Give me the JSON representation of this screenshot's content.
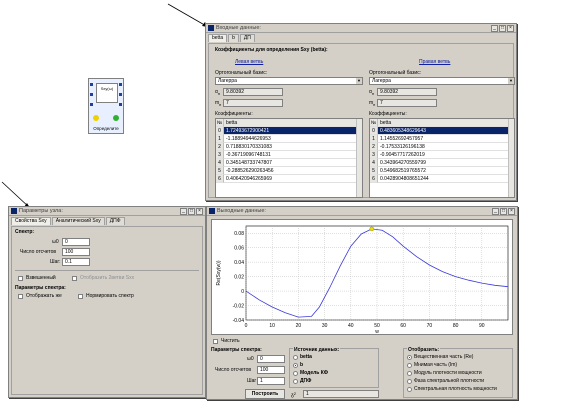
{
  "win_input": {
    "title": "Входные данные:",
    "tabs": [
      "betta",
      "b",
      "ДП"
    ],
    "heading": "Коэффициенты для определения Sxy (betta):",
    "left_link": "Левая ветвь",
    "right_link": "Правая ветвь",
    "basis_label": "Ортогональный базис:",
    "basis_value": "Лагерра",
    "alpha_label": "α",
    "alpha_sub": "п",
    "alpha_value": "9.80392",
    "m_label": "m",
    "m_sub": "п",
    "m_value": "7",
    "coeff_label": "Коэффициенты:",
    "col_n": "№",
    "col_betta": "betta",
    "left_coeffs": [
      "1.72493672900421",
      "-1.18894944626953",
      "0.718830170331083",
      "-0.36719096748131",
      "0.345148733747807",
      "-0.288526290263456",
      "0.406420946265969"
    ],
    "right_coeffs": [
      "0.483605348629643",
      "1.14552692457957",
      "-0.17533126196138",
      "-0.90457717262019",
      "0.343964270559799",
      "0.549682519765572",
      "0.0428904808651244"
    ],
    "left_alpha": "9.80392",
    "left_m": "7",
    "right_alpha": "9.80392",
    "right_m": "7"
  },
  "win_params": {
    "title": "Параметры узла:",
    "tabs": [
      "Свойства Sxy",
      "Аналитический Sxy",
      "ДПФ"
    ],
    "spectrum_label": "Спектр:",
    "w0_label": "ω0",
    "w0_value": "0",
    "count_label": "Число отсчетов",
    "count_value": "100",
    "step_label": "Шаг:",
    "step_value": "0.1",
    "weighted_label": "Взвешенный",
    "show_weight_label": "Отобразить 2ветви Sxx",
    "spectrum_params_label": "Параметры спектра:",
    "show_label": "Отображать же",
    "normalize_label": "Нормировать спектр"
  },
  "win_output": {
    "title": "Выходные данные:",
    "clear_label": "Чистить",
    "params_label": "Параметры спектра:",
    "w0_label": "ω0",
    "w0_value": "0",
    "count_label": "Число отсчетов",
    "count_value": "100",
    "step_label": "Шаг",
    "step_value": "1",
    "build_label": "Построить",
    "source_label": "Источник данных:",
    "sources": [
      "betta",
      "b",
      "Модель КФ",
      "ДПФ"
    ],
    "delta_label": "δ",
    "delta_sup": "2",
    "delta_value": "1",
    "display_label": "Отобразить:",
    "display_options": [
      "Вещественная часть (Re)",
      "Мнимая часть (Im)",
      "Модуль плотности мощности",
      "Фаза спектральной плотности",
      "Спектральная плотность мощности"
    ]
  },
  "node": {
    "label": "Определите",
    "formula": "Sxy(ω)"
  },
  "chart_data": {
    "type": "line",
    "xlabel": "w",
    "ylabel": "Re(Sxy(w))",
    "xlim": [
      0,
      100
    ],
    "ylim": [
      -0.04,
      0.09
    ],
    "xticks": [
      0,
      10,
      20,
      30,
      40,
      50,
      60,
      70,
      80,
      90
    ],
    "yticks": [
      0.08,
      0.06,
      0.04,
      0.02,
      0,
      -0.02,
      -0.04
    ],
    "x": [
      0,
      5,
      10,
      15,
      20,
      25,
      28,
      32,
      36,
      40,
      44,
      48,
      52,
      56,
      60,
      65,
      70,
      75,
      80,
      85,
      90,
      95,
      100
    ],
    "y": [
      0.0,
      -0.012,
      -0.022,
      -0.03,
      -0.036,
      -0.035,
      -0.022,
      0.005,
      0.035,
      0.062,
      0.079,
      0.086,
      0.084,
      0.075,
      0.062,
      0.048,
      0.036,
      0.027,
      0.02,
      0.015,
      0.011,
      0.008,
      0.006
    ],
    "color": "#3a3adb"
  }
}
